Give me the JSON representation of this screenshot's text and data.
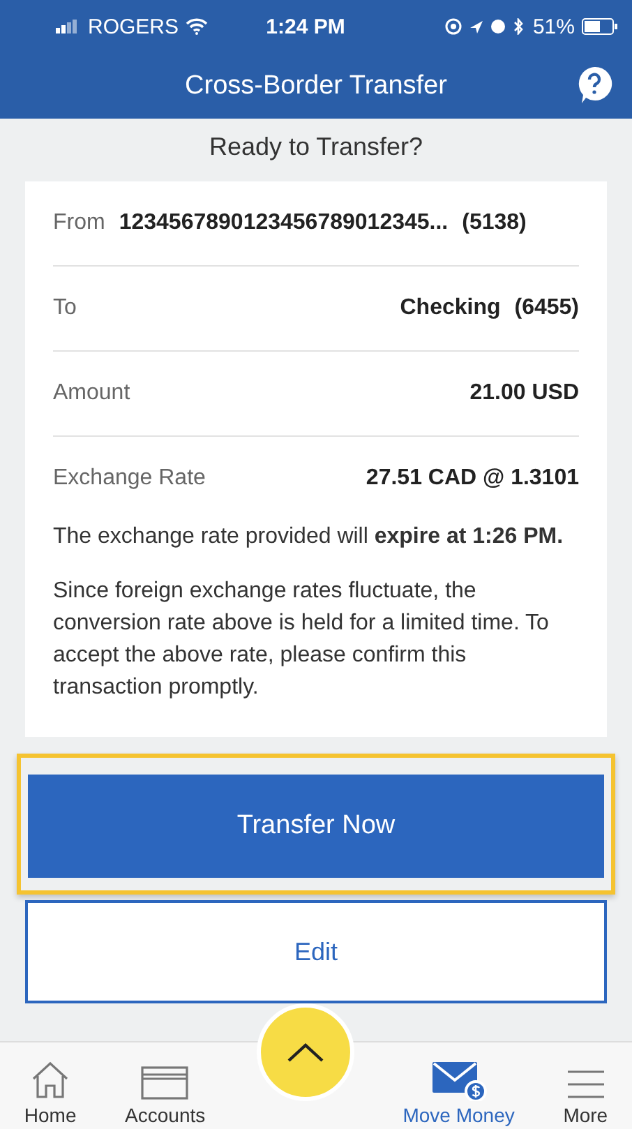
{
  "status_bar": {
    "carrier": "ROGERS",
    "time": "1:24 PM",
    "battery": "51%"
  },
  "header": {
    "title": "Cross-Border Transfer"
  },
  "subtitle": "Ready to Transfer?",
  "details": [
    {
      "kind": "account",
      "label": "From",
      "value": "1234567890123456789012345...",
      "suffix": "(5138)"
    },
    {
      "kind": "account",
      "label": "To",
      "value": "Checking",
      "suffix": "(6455)"
    },
    {
      "kind": "plain",
      "label": "Amount",
      "value": "21.00 USD"
    },
    {
      "kind": "plain",
      "label": "Exchange Rate",
      "value": "27.51 CAD @ 1.3101"
    }
  ],
  "notes": [
    "The exchange rate provided will **expire at 1:26 PM.**",
    "Since foreign exchange rates fluctuate, the conversion rate above is held for a limited time. To accept the above rate, please confirm this transaction promptly."
  ],
  "primary_button": {
    "label": "Transfer Now",
    "focused": true
  },
  "secondary_button": {
    "label": "Edit"
  },
  "tabs": [
    {
      "label": "Home",
      "selected": false
    },
    {
      "label": "Accounts",
      "selected": false
    },
    {
      "label": "Move Money",
      "selected": true
    },
    {
      "label": "More",
      "selected": false
    }
  ]
}
